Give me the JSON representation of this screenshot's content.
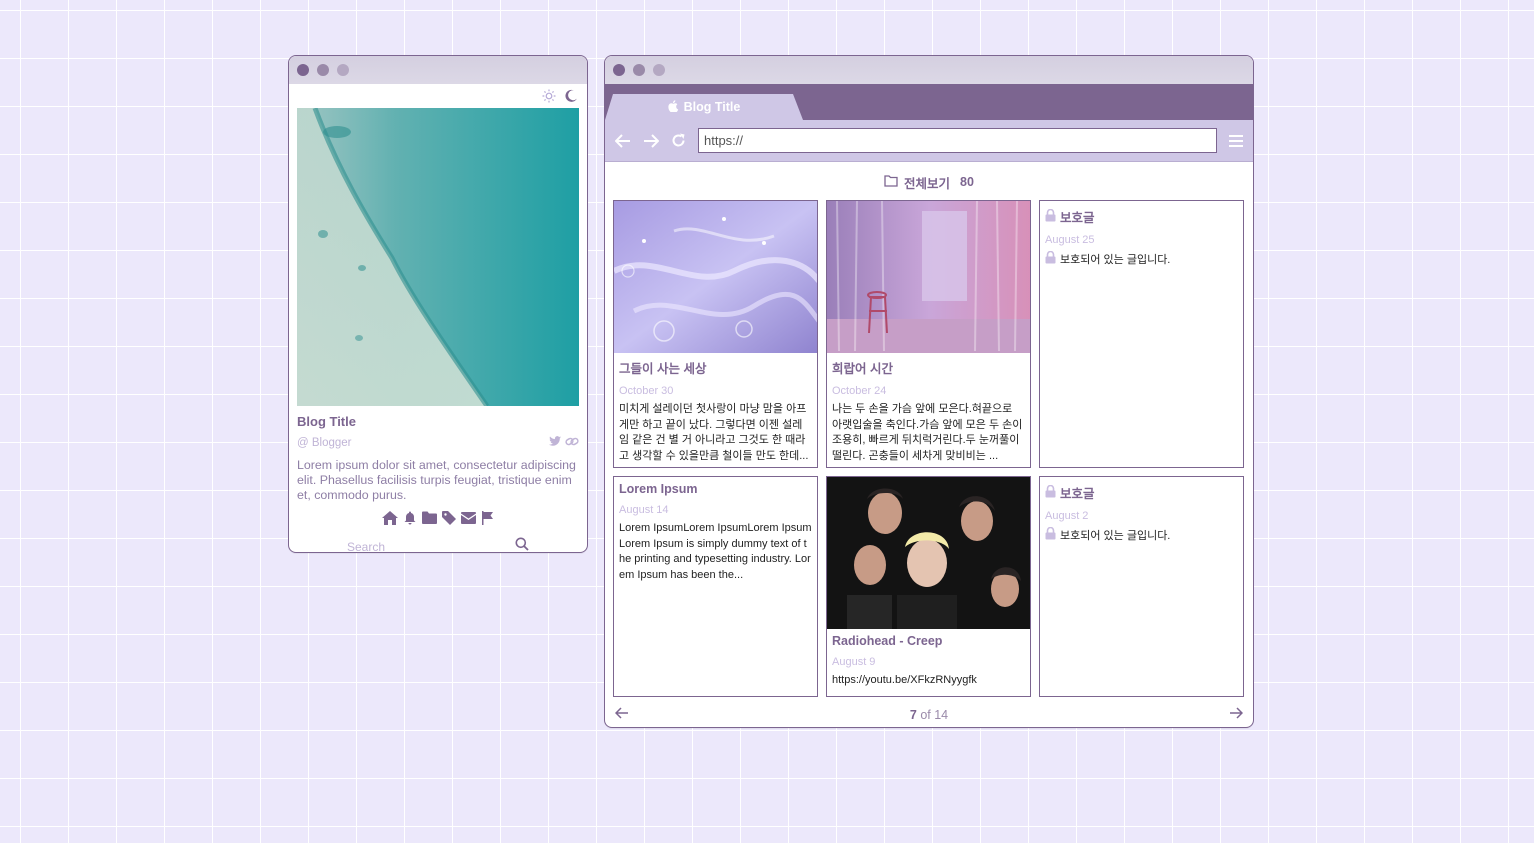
{
  "profile": {
    "blog_title": "Blog Title",
    "handle": "@ Blogger",
    "description": "Lorem ipsum dolor sit amet, consectetur adipiscing elit. Phasellus facilisis turpis feugiat, tristique enim et, commodo purus.",
    "search_placeholder": "Search",
    "icons": [
      "home-icon",
      "bell-icon",
      "folder-icon",
      "tag-icon",
      "mail-icon",
      "flag-icon"
    ]
  },
  "browser": {
    "tab_label": "Blog Title",
    "url_value": "https://",
    "category": {
      "label": "전체보기",
      "count": "80"
    },
    "posts": [
      {
        "title": "그들이 사는 세상",
        "date": "October 30",
        "excerpt": "미치게 설레이던 첫사랑이 마냥 맘을 아프게만 하고 끝이 났다. 그렇다면 이젠 설레임 같은 건 별 거 아니라고 그것도 한 때라고 생각할 수 있을만큼 철이들 만도 한데..."
      },
      {
        "title": "희랍어 시간",
        "date": "October 24",
        "excerpt": "나는 두 손을 가슴 앞에 모은다.혀끝으로 아랫입술을 축인다.가슴 앞에 모은 두 손이 조용히, 빠르게 뒤치럭거린다.두 눈꺼풀이 떨린다. 곤충들이 세차게 맞비비는 ..."
      },
      {
        "title": "보호글",
        "date": "August 25",
        "excerpt": "보호되어 있는 글입니다."
      },
      {
        "title": "Lorem Ipsum",
        "date": "August 14",
        "excerpt": "Lorem IpsumLorem IpsumLorem IpsumLorem Ipsum is simply dummy text of the printing and typesetting industry. Lorem Ipsum has been the..."
      },
      {
        "title": "Radiohead - Creep",
        "date": "August 9",
        "excerpt": "https://youtu.be/XFkzRNyygfk"
      },
      {
        "title": "보호글",
        "date": "August 2",
        "excerpt": "보호되어 있는 글입니다."
      }
    ],
    "pager": {
      "current": "7",
      "of_text": "of 14"
    }
  },
  "colors": {
    "accent": "#7c6590",
    "tab": "#cfc7e6",
    "background": "#ece8fb"
  }
}
